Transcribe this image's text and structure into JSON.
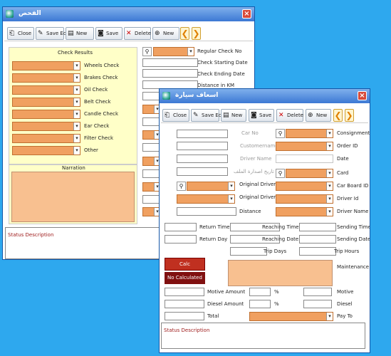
{
  "back_window": {
    "title": "الفحص",
    "toolbar": {
      "close": "Close",
      "save_edit": "Save Edit",
      "new1": "New",
      "save": "Save",
      "delete": "Delete",
      "new2": "New",
      "prev": "❮",
      "next": "❯"
    },
    "check_results_header": "Check Results",
    "checks": [
      "Wheels Check",
      "Brakes Check",
      "Oil Check",
      "Belt Check",
      "Candle Check",
      "Ear Check",
      "Filter Check",
      "Other"
    ],
    "narration_header": "Narration",
    "right_labels": [
      "Regular Check No",
      "Check Starting Date",
      "Check Ending Date",
      "Distance in KM"
    ],
    "status": "Status Description"
  },
  "front_window": {
    "title": "اسعاف سيارة",
    "toolbar": {
      "close": "Close",
      "save_edit": "Save Edit",
      "new1": "New",
      "save": "Save",
      "delete": "Delete",
      "new2": "New",
      "prev": "❮",
      "next": "❯"
    },
    "labels": {
      "car_no": "Car No",
      "customer_name": "Customername",
      "driver_name_gray": "Driver Name",
      "report_date": "تاريخ اصدارة الملف",
      "consignment": "Consignment ID",
      "order_id": "Order ID",
      "date": "Date",
      "card": "Card",
      "car_board": "Car Board ID",
      "driver_id": "Driver Id",
      "driver_name": "Driver Name",
      "original_driver1": "Original Driver",
      "original_driver2": "Original Driver",
      "distance": "Distance",
      "return_time": "Return Time",
      "return_day": "Return Day",
      "reaching_time": "Reaching Time",
      "reaching_date": "Reaching Date",
      "trip_days": "Trip Days",
      "sending_time": "Sending Time",
      "sending_date": "Sending Date",
      "trip_hours": "Trip Hours",
      "maintenance": "Maintenance",
      "motive_amount": "Motive Amount",
      "diesel_amount": "Diesel Amount",
      "total": "Total",
      "motive": "Motive",
      "diesel": "Diesel",
      "pay_to": "Pay To",
      "pct1": "%",
      "pct2": "%"
    },
    "calc_button": "Calc",
    "not_calculated": "No Calculated",
    "status": "Status Description"
  }
}
